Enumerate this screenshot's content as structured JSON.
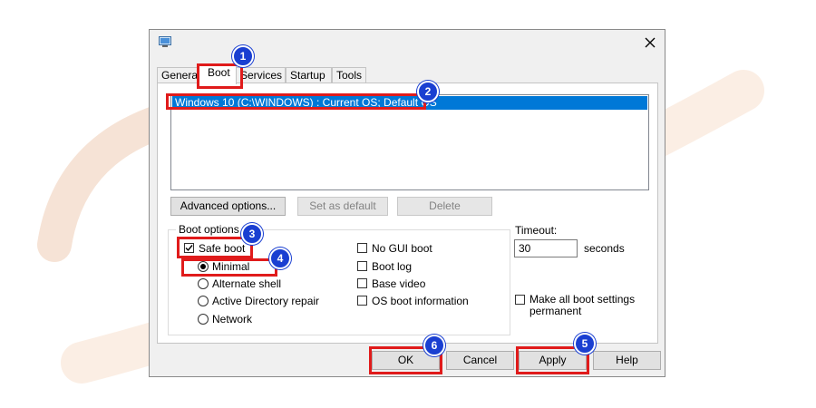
{
  "tabs": [
    {
      "label": "General"
    },
    {
      "label": "Boot"
    },
    {
      "label": "Services"
    },
    {
      "label": "Startup"
    },
    {
      "label": "Tools"
    }
  ],
  "boot_entries": [
    {
      "label": "Windows 10 (C:\\WINDOWS) : Current OS; Default OS",
      "selected": true
    }
  ],
  "entry_buttons": {
    "advanced": "Advanced options...",
    "set_default": "Set as default",
    "delete": "Delete"
  },
  "boot_options": {
    "group_label": "Boot options",
    "safe_boot": {
      "label": "Safe boot",
      "checked": true
    },
    "safe_boot_modes": [
      {
        "label": "Minimal",
        "selected": true
      },
      {
        "label": "Alternate shell",
        "selected": false
      },
      {
        "label": "Active Directory repair",
        "selected": false
      },
      {
        "label": "Network",
        "selected": false
      }
    ],
    "flags": [
      {
        "label": "No GUI boot",
        "checked": false
      },
      {
        "label": "Boot log",
        "checked": false
      },
      {
        "label": "Base video",
        "checked": false
      },
      {
        "label": "OS boot information",
        "checked": false
      }
    ]
  },
  "timeout": {
    "label": "Timeout:",
    "value": "30",
    "unit": "seconds"
  },
  "permanent": {
    "label_line1": "Make all boot settings",
    "label_line2": "permanent",
    "checked": false
  },
  "footer": {
    "ok": "OK",
    "cancel": "Cancel",
    "apply": "Apply",
    "help": "Help"
  },
  "steps": {
    "boot_tab": "1",
    "os_entry": "2",
    "safe_boot": "3",
    "minimal": "4",
    "apply": "5",
    "ok": "6"
  },
  "colors": {
    "highlight": "#e01b1b",
    "badge": "#1a3fd1",
    "selection": "#0078d7"
  },
  "icons": {
    "title": "system-configuration-icon",
    "close": "close-icon",
    "checkmark": "checkmark-icon"
  }
}
